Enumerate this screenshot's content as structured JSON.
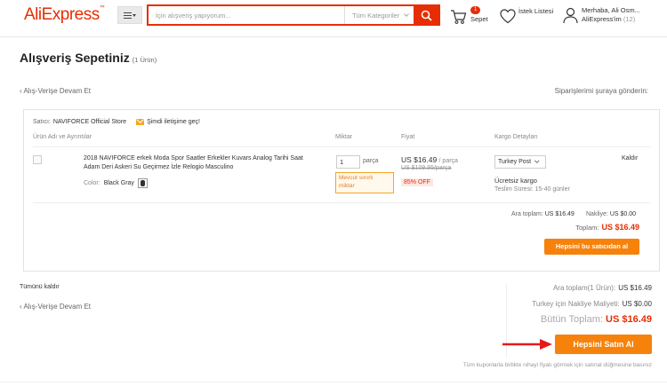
{
  "header": {
    "logo": "AliExpress",
    "search_placeholder": "İçin alışveriş yapıyorum...",
    "category": "Tüm Kategoriler",
    "cart_count": "1",
    "cart_label": "Sepet",
    "wishlist_label": "İstek Listesi",
    "greeting": "Merhaba, Ali Osm...",
    "account_label": "AliExpress'im",
    "account_count": "(12)"
  },
  "page": {
    "title": "Alışveriş Sepetiniz",
    "item_count": "(1 Ürün)",
    "back_link": "‹ Alış-Verişe Devam Et",
    "ship_to": "Siparişlerimi şuraya gönderin:"
  },
  "store": {
    "seller_label": "Satıcı:",
    "seller_name": "NAVIFORCE Official Store",
    "contact_label": "Şimdi iletişime geç!",
    "columns": {
      "product": "Ürün Adı ve Ayrıntılar",
      "quantity": "Miktar",
      "price": "Fiyat",
      "shipping": "Kargo Detayları"
    },
    "item": {
      "title": "2018 NAVIFORCE erkek Moda Spor Saatler Erkekler Kuvars Analog Tarihi Saat Adam Deri Askeri Su Geçirmez İzle Relogio Masculino",
      "color_label": "Color:",
      "color_value": "Black Gray",
      "quantity": "1",
      "quantity_unit": "parça",
      "limited_note": "Mevcut sınırlı miktar",
      "price": "US $16.49",
      "price_per": "/ parça",
      "old_price": "US $109.95/parça",
      "discount": "85% OFF",
      "shipping_method": "Turkey Post",
      "free_shipping": "Ücretsiz kargo",
      "delivery_time": "Teslim Süresi: 15-40 günler",
      "remove_label": "Kaldır"
    },
    "subtotal_label": "Ara toplam:",
    "subtotal_value": "US $16.49",
    "shipping_label": "Nakliye:",
    "shipping_value": "US $0.00",
    "total_label": "Toplam:",
    "total_value": "US $16.49",
    "buy_all_label": "Hepsini bu satıcıdan al"
  },
  "summary": {
    "remove_all": "Tümünü kaldır",
    "back_link": "‹ Alış-Verişe Devam Et",
    "subtotal_label": "Ara toplam(1 Ürün):",
    "subtotal_value": "US $16.49",
    "shipping_label": "Turkey için Nakliye Maliyeti:",
    "shipping_value": "US $0.00",
    "grand_label": "Bütün Toplam:",
    "grand_value": "US $16.49",
    "buy_button": "Hepsini Satın Al",
    "coupon_note": "Tüm kuponlarla birlikte nihayi fiyatı görmek için satınal düğmesine basınız"
  },
  "colors": {
    "brand": "#e62e04",
    "button": "#f7820b",
    "annotation_arrow": "#e31b1b"
  }
}
